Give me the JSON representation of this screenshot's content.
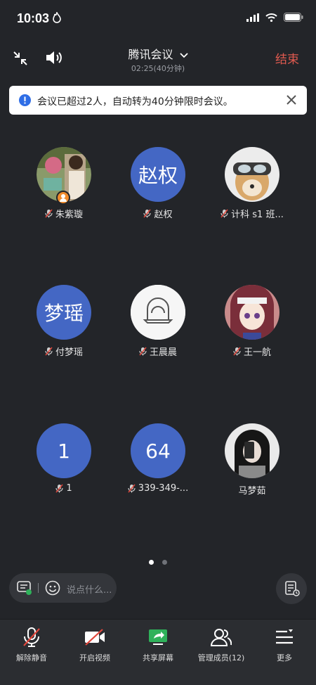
{
  "status_bar": {
    "time": "10:03"
  },
  "header": {
    "title": "腾讯会议",
    "subtitle": "02:25(40分钟)",
    "end_label": "结束"
  },
  "notice": {
    "text": "会议已超过2人，自动转为40分钟限时会议。"
  },
  "participants": [
    {
      "name": "朱紫璇",
      "avatar": "photo",
      "host": true
    },
    {
      "name": "赵权",
      "avatar_text": "赵权"
    },
    {
      "name": "计科 s1 班...",
      "avatar": "photo"
    },
    {
      "name": "付梦瑶",
      "avatar_text": "梦瑶"
    },
    {
      "name": "王晨晨",
      "avatar": "photo"
    },
    {
      "name": "王一航",
      "avatar": "photo"
    },
    {
      "name": "1",
      "avatar_text": "1"
    },
    {
      "name": "339-349-...",
      "avatar_text": "64"
    },
    {
      "name": "马梦茹",
      "avatar": "photo",
      "muted": false
    }
  ],
  "pager": {
    "pages": 2,
    "current": 1
  },
  "chat": {
    "placeholder": "说点什么..."
  },
  "toolbar": {
    "unmute": "解除静音",
    "video": "开启视频",
    "share": "共享屏幕",
    "members": "管理成员(12)",
    "more": "更多"
  },
  "colors": {
    "background": "#232529",
    "avatar_blue": "#4467c4",
    "end_red": "#e05a4f",
    "share_green": "#2fb15a",
    "muted_red": "#e0473c"
  }
}
